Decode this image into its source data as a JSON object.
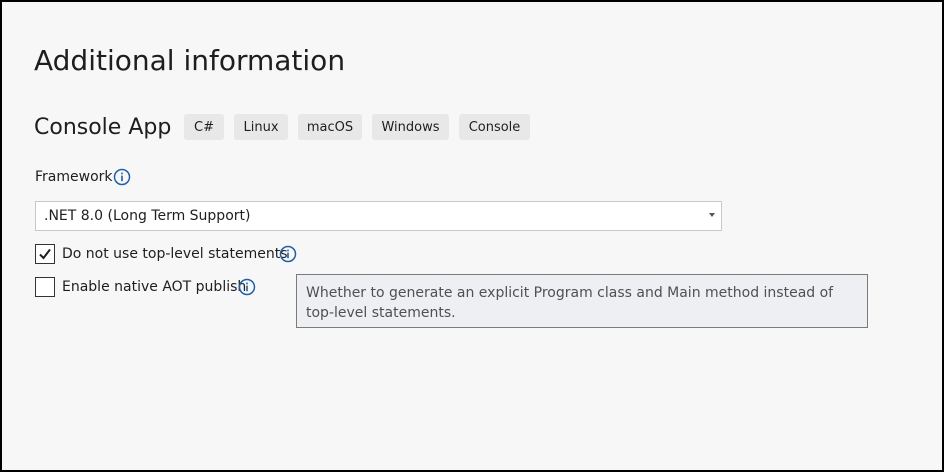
{
  "dialog": {
    "title": "Additional information",
    "project_type": "Console App",
    "tags": [
      "C#",
      "Linux",
      "macOS",
      "Windows",
      "Console"
    ]
  },
  "framework": {
    "label": "Framework",
    "selected": ".NET 8.0 (Long Term Support)"
  },
  "options": {
    "top_level_statements": {
      "label": "Do not use top-level statements",
      "checked": true
    },
    "native_aot": {
      "label": "Enable native AOT publish",
      "checked": false
    }
  },
  "tooltip": {
    "text": "Whether to generate an explicit Program class and Main method instead of top-level statements."
  },
  "colors": {
    "info_icon": "#1f5fa8",
    "tag_bg": "#e8e8e8"
  },
  "icons": [
    "info-icon",
    "checkmark-icon",
    "chevron-down-icon"
  ]
}
